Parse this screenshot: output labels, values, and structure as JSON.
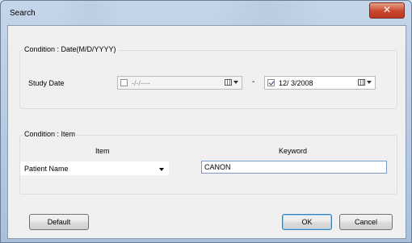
{
  "window": {
    "title": "Search",
    "close_glyph": "✕"
  },
  "date_group": {
    "title": "Condition : Date(M/D/YYYY)",
    "label": "Study Date",
    "from": {
      "checked": false,
      "value": "-/-/----"
    },
    "separator": "-",
    "to": {
      "checked": true,
      "value": "12/ 3/2008"
    }
  },
  "item_group": {
    "title": "Condition : Item",
    "item_header": "Item",
    "keyword_header": "Keyword",
    "item_selected": "Patient Name",
    "keyword_value": "CANON"
  },
  "buttons": {
    "default_label": "Default",
    "ok_label": "OK",
    "cancel_label": "Cancel"
  }
}
